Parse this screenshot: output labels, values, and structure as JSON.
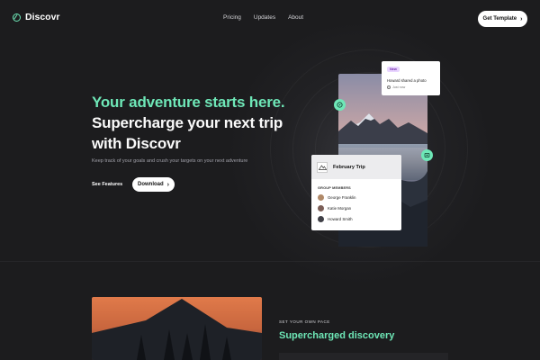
{
  "nav": {
    "brand": "Discovr",
    "links": [
      "Pricing",
      "Updates",
      "About"
    ],
    "cta_label": "Get Template"
  },
  "hero": {
    "headline_accent": "Your adventure starts here.",
    "headline_line2": "Supercharge your next trip",
    "headline_line3": "with Discovr",
    "lead": "Keep track of your goals and crush your targets on your next adventure",
    "secondary_label": "See Features",
    "primary_label": "Download"
  },
  "notification": {
    "badge": "New",
    "message": "Howard shared a photo",
    "time": "Just now"
  },
  "trip_card": {
    "title": "February Trip",
    "section_label": "GROUP MEMBERS",
    "members": [
      "George Franklin",
      "Katie Morgan",
      "Howard Smith"
    ]
  },
  "feature": {
    "eyebrow": "SET YOUR OWN PACE",
    "title": "Supercharged discovery"
  },
  "colors": {
    "accent": "#6ee7b7",
    "background": "#1c1c1e",
    "card": "#ffffff"
  },
  "icons": [
    "compass-icon",
    "chevron-right-icon",
    "mountain-icon",
    "clock-icon",
    "photo-icon"
  ]
}
